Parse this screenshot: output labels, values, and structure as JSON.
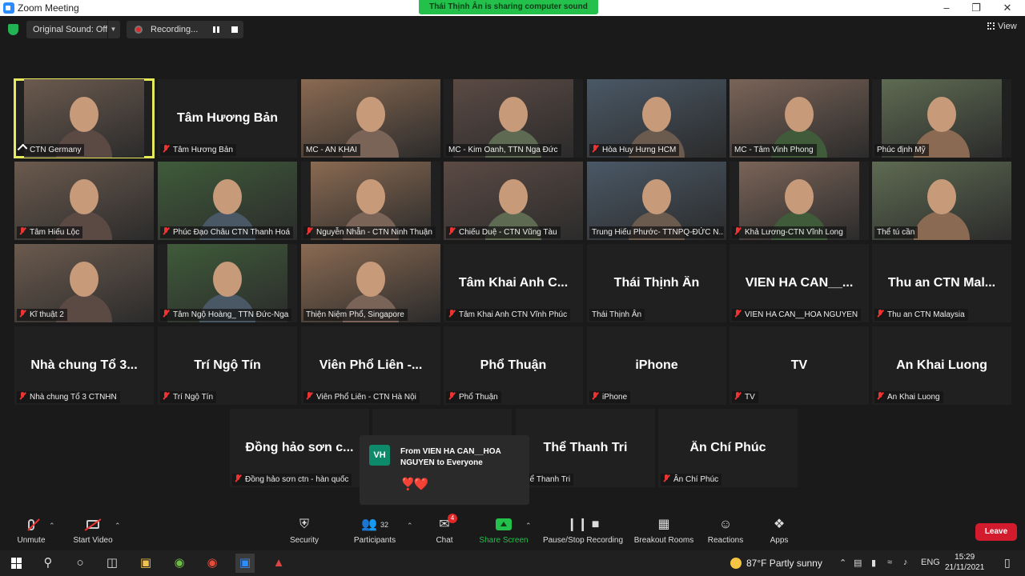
{
  "window": {
    "title": "Zoom Meeting"
  },
  "share_banner": "Thái Thịnh Ân is sharing computer sound",
  "topbar": {
    "original_sound": "Original Sound: Off",
    "recording": "Recording...",
    "view": "View"
  },
  "tiles": [
    {
      "label": "CTN Germany",
      "muted": false,
      "pinned": true,
      "video": true,
      "active": true
    },
    {
      "label": "Tâm Hương Bản",
      "name": "Tâm Hương Bản",
      "muted": true,
      "video": false
    },
    {
      "label": "MC - AN KHAI",
      "muted": false,
      "video": true
    },
    {
      "label": "MC - Kim Oanh, TTN Nga Đức",
      "muted": false,
      "video": true
    },
    {
      "label": "Hòa Huy Hưng HCM",
      "muted": true,
      "video": true
    },
    {
      "label": "MC - Tâm Vinh Phong",
      "muted": false,
      "video": true
    },
    {
      "label": "Phúc định Mỹ",
      "muted": false,
      "video": true
    },
    {
      "label": "Tâm Hiếu Lộc",
      "muted": true,
      "video": true
    },
    {
      "label": "Phúc Đạo Châu CTN Thanh Hoá",
      "muted": true,
      "video": true
    },
    {
      "label": "Nguyễn Nhẫn - CTN Ninh Thuận",
      "muted": true,
      "video": true
    },
    {
      "label": "Chiếu Duệ - CTN Vũng Tàu",
      "muted": true,
      "video": true
    },
    {
      "label": "Trung Hiếu Phước- TTNPQ-ĐỨC N...",
      "muted": false,
      "video": true
    },
    {
      "label": "Khả Lương-CTN Vĩnh Long",
      "muted": true,
      "video": true
    },
    {
      "label": "Thể tú cần",
      "muted": false,
      "video": true
    },
    {
      "label": "Kĩ thuật 2",
      "muted": true,
      "video": true
    },
    {
      "label": "Tâm Ngộ Hoàng_ TTN Đức-Nga",
      "muted": true,
      "video": true
    },
    {
      "label": "Thiện Niệm Phổ, Singapore",
      "muted": false,
      "video": true
    },
    {
      "label": "Tâm Khai Anh CTN Vĩnh Phúc",
      "name": "Tâm Khai Anh C...",
      "muted": true,
      "video": false
    },
    {
      "label": "Thái Thịnh Ân",
      "name": "Thái Thịnh Ân",
      "muted": false,
      "video": false
    },
    {
      "label": "VIEN HA CAN__HOA NGUYEN",
      "name": "VIEN HA CAN__...",
      "muted": true,
      "video": false
    },
    {
      "label": "Thu an CTN Malaysia",
      "name": "Thu an CTN Mal...",
      "muted": true,
      "video": false
    },
    {
      "label": "Nhà chung Tổ 3 CTNHN",
      "name": "Nhà chung Tổ 3...",
      "muted": true,
      "video": false
    },
    {
      "label": "Trí Ngộ Tín",
      "name": "Trí Ngộ Tín",
      "muted": true,
      "video": false
    },
    {
      "label": "Viên Phổ Liên - CTN Hà Nội",
      "name": "Viên Phổ Liên -...",
      "muted": true,
      "video": false
    },
    {
      "label": "Phổ Thuận",
      "name": "Phổ Thuận",
      "muted": true,
      "video": false
    },
    {
      "label": "iPhone",
      "name": "iPhone",
      "muted": true,
      "video": false
    },
    {
      "label": "TV",
      "name": "TV",
      "muted": true,
      "video": false
    },
    {
      "label": "An Khai Luong",
      "name": "An Khai Luong",
      "muted": true,
      "video": false
    },
    {
      "label": "Đồng hảo sơn ctn - hàn quốc",
      "name": "Đồng hảo sơn c...",
      "muted": true,
      "video": false
    },
    {
      "label": "",
      "name": "",
      "muted": false,
      "video": false
    },
    {
      "label": "Thể Thanh Tri",
      "name": "Thể Thanh Tri",
      "muted": false,
      "video": false
    },
    {
      "label": "Ân Chí Phúc",
      "name": "Ân Chí Phúc",
      "muted": true,
      "video": false
    }
  ],
  "chat_popup": {
    "avatar": "VH",
    "from": "From VIEN HA CAN__HOA NGUYEN to Everyone",
    "message": "❣️❤️"
  },
  "toolbar": {
    "unmute": "Unmute",
    "start_video": "Start Video",
    "security": "Security",
    "participants": "Participants",
    "participants_count": "32",
    "chat": "Chat",
    "chat_badge": "4",
    "share_screen": "Share Screen",
    "pause_stop": "Pause/Stop Recording",
    "breakout": "Breakout Rooms",
    "reactions": "Reactions",
    "apps": "Apps",
    "leave": "Leave"
  },
  "taskbar": {
    "weather": "87°F  Partly sunny",
    "lang": "ENG",
    "time": "15:29",
    "date": "21/11/2021"
  },
  "colors": {
    "active_speaker": "#e6ea5a",
    "share_green": "#23c04b",
    "leave_red": "#d21c2e",
    "muted_red": "#e33333"
  }
}
